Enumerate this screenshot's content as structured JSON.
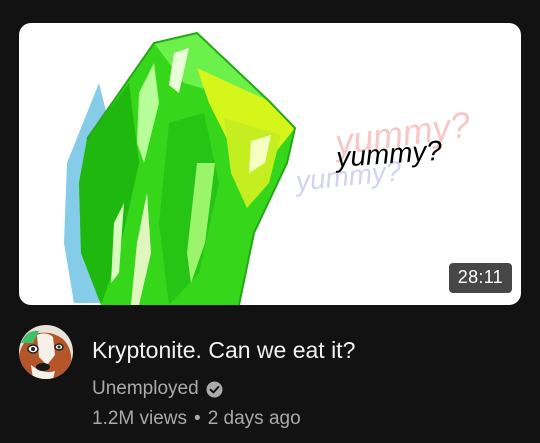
{
  "video": {
    "thumbnail_caption": "yummy?",
    "duration": "28:11",
    "title": "Kryptonite. Can we eat it?",
    "channel": "Unemployed",
    "views": "1.2M views",
    "separator": "•",
    "age": "2 days ago"
  },
  "icons": {
    "verified": "check-circle-icon"
  },
  "colors": {
    "background": "#121212",
    "title_text": "#f1f1f1",
    "secondary_text": "#aaaaaa",
    "crystal_green": "#39e21a",
    "crystal_yellow": "#d6f51b"
  }
}
